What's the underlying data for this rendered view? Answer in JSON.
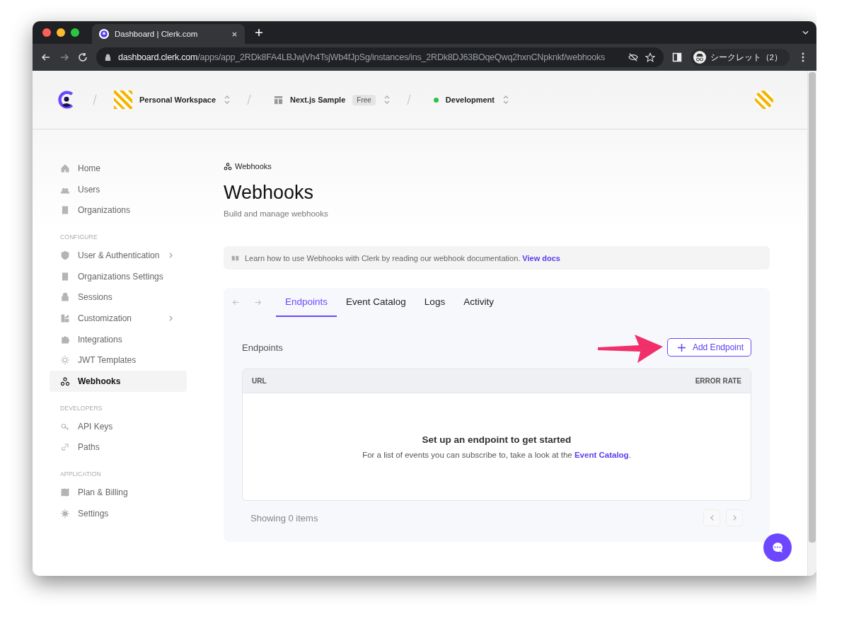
{
  "browser": {
    "tab_title": "Dashboard | Clerk.com",
    "url_host": "dashboard.clerk.com",
    "url_path": "/apps/app_2RDk8FA4LBJwjVh4TsjWb4fJpSg/instances/ins_2RDk8DJ63BOqeQwq2hxnCNpknkf/webhooks",
    "profile_label": "シークレット（2）"
  },
  "header": {
    "workspace": "Personal Workspace",
    "app": "Next.js Sample",
    "app_badge": "Free",
    "instance": "Development"
  },
  "sidebar": {
    "sections": [
      {
        "items": [
          {
            "label": "Home",
            "selected": false,
            "expandable": false
          },
          {
            "label": "Users",
            "selected": false,
            "expandable": false
          },
          {
            "label": "Organizations",
            "selected": false,
            "expandable": false
          }
        ]
      },
      {
        "heading": "CONFIGURE",
        "items": [
          {
            "label": "User & Authentication",
            "selected": false,
            "expandable": true
          },
          {
            "label": "Organizations Settings",
            "selected": false,
            "expandable": false
          },
          {
            "label": "Sessions",
            "selected": false,
            "expandable": false
          },
          {
            "label": "Customization",
            "selected": false,
            "expandable": true
          },
          {
            "label": "Integrations",
            "selected": false,
            "expandable": false
          },
          {
            "label": "JWT Templates",
            "selected": false,
            "expandable": false
          },
          {
            "label": "Webhooks",
            "selected": true,
            "expandable": false
          }
        ]
      },
      {
        "heading": "DEVELOPERS",
        "items": [
          {
            "label": "API Keys",
            "selected": false,
            "expandable": false
          },
          {
            "label": "Paths",
            "selected": false,
            "expandable": false
          }
        ]
      },
      {
        "heading": "APPLICATION",
        "items": [
          {
            "label": "Plan & Billing",
            "selected": false,
            "expandable": false
          },
          {
            "label": "Settings",
            "selected": false,
            "expandable": false
          }
        ]
      }
    ]
  },
  "page": {
    "breadcrumb": "Webhooks",
    "title": "Webhooks",
    "subtitle": "Build and manage webhooks",
    "notice": "Learn how to use Webhooks with Clerk by reading our webhook documentation.",
    "notice_link": "View docs"
  },
  "tabs": [
    {
      "label": "Endpoints",
      "selected": true
    },
    {
      "label": "Event Catalog",
      "selected": false
    },
    {
      "label": "Logs",
      "selected": false
    },
    {
      "label": "Activity",
      "selected": false
    }
  ],
  "endpoints": {
    "heading": "Endpoints",
    "add_button": "Add Endpoint",
    "columns": [
      "URL",
      "ERROR RATE"
    ],
    "empty_title": "Set up an endpoint to get started",
    "empty_text": "For a list of events you can subscribe to, take a look at the",
    "empty_link": "Event Catalog",
    "empty_end": ".",
    "footer": "Showing 0 items"
  }
}
